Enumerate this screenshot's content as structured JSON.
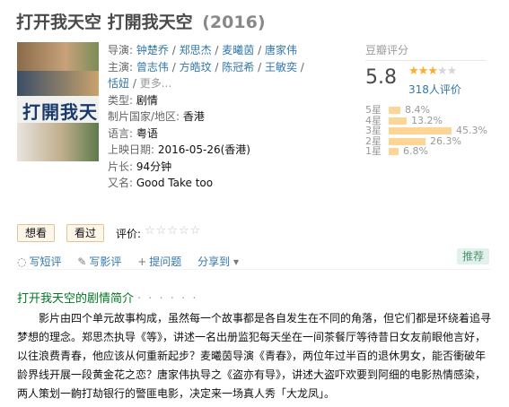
{
  "movie": {
    "title": "打开我天空 打開我天空",
    "year": "(2016)"
  },
  "info": {
    "director_label": "导演:",
    "directors": [
      "钟楚乔",
      "郑思杰",
      "麦曦茵",
      "唐家伟"
    ],
    "cast_label": "主演:",
    "cast": [
      "曾志伟",
      "方皓玟",
      "陈冠希",
      "王敏奕",
      "恬妞"
    ],
    "more": "更多...",
    "genre_label": "类型:",
    "genre": "剧情",
    "country_label": "制片国家/地区:",
    "country": "香港",
    "language_label": "语言:",
    "language": "粤语",
    "release_label": "上映日期:",
    "release": "2016-05-26(香港)",
    "runtime_label": "片长:",
    "runtime": "94分钟",
    "aka_label": "又名:",
    "aka": "Good Take too"
  },
  "poster": {
    "title_text": "打開我天空"
  },
  "rating": {
    "header": "豆瓣评分",
    "score": "5.8",
    "stars_filled": 3,
    "stars_total": 5,
    "votes": "318人评价",
    "distribution": [
      {
        "label": "5星",
        "pct": "8.4%",
        "value": 8.4
      },
      {
        "label": "4星",
        "pct": "13.2%",
        "value": 13.2
      },
      {
        "label": "3星",
        "pct": "45.3%",
        "value": 45.3
      },
      {
        "label": "2星",
        "pct": "26.3%",
        "value": 26.3
      },
      {
        "label": "1星",
        "pct": "6.8%",
        "value": 6.8
      }
    ]
  },
  "actions": {
    "want": "想看",
    "seen": "看过",
    "rate_label": "评价:",
    "rate_stars": "☆☆☆☆☆"
  },
  "share": {
    "write_short": "写短评",
    "write_review": "写影评",
    "ask": "提问题",
    "share_to": "分享到",
    "recommend": "推荐"
  },
  "synopsis": {
    "title": "打开我天空的剧情简介",
    "dots": "· · · · · ·",
    "text": "影片由四个单元故事构成，虽然每一个故事都是各自发生在不同的角落，但它们都是环绕着追寻梦想的理念。郑思杰执导《等》，讲述一名出册监犯每天坐在一间茶餐厅等待昔日女友前眼他言好，以往浪费青春，他应该从何重新起步？麦曦茵导演《青春》，两位年过半百的退休男女，能否衝破年龄界线开展一段黄金花之恋？唐家伟执导之《盗亦有导》，讲述大盗吓欢要到阿细的电影热情感染，两人策划一齣打劫银行的警匪电影，决定来一场真人秀「大龙凤」。"
  }
}
